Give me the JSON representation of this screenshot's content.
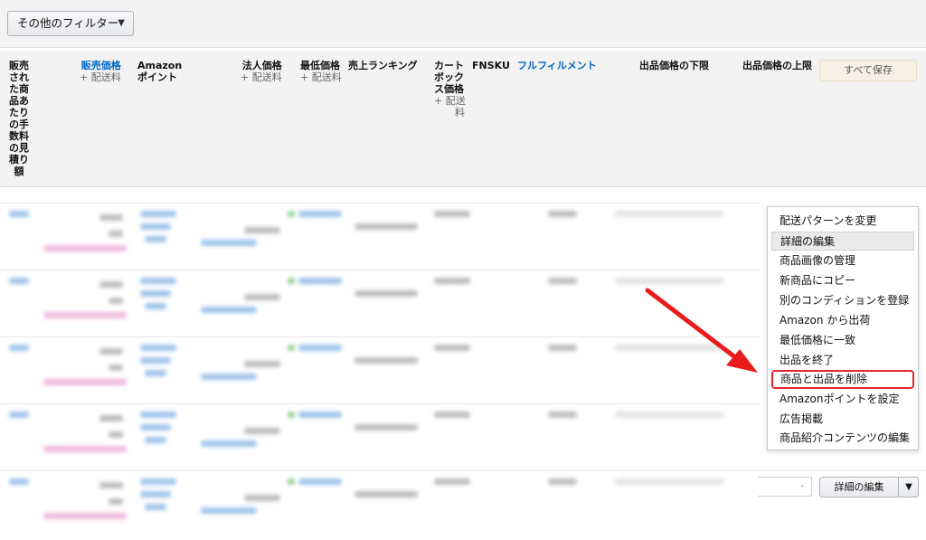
{
  "filter": {
    "label": "その他のフィルター"
  },
  "header": {
    "fee_lines": [
      "販売",
      "され",
      "た商",
      "品あ",
      "たり",
      "の手",
      "数料",
      "の見",
      "積り",
      "額"
    ],
    "sale_price": "販売価格",
    "shipping": "+ 配送料",
    "amazon_point_1": "Amazon",
    "amazon_point_2": "ポイント",
    "business_price": "法人価格",
    "lowest_price": "最低価格",
    "sales_rank": "売上ランキング",
    "cart_lines": [
      "カート",
      "ボック",
      "ス価格"
    ],
    "cart_ship_1": "+ 配送",
    "cart_ship_2": "料",
    "fnsku": "FNSKU",
    "fulfillment": "フルフィルメント",
    "min_price": "出品価格の下限",
    "max_price": "出品価格の上限",
    "save_all": "すべて保存"
  },
  "row_controls": {
    "edit_button": "詳細の編集"
  },
  "menu": {
    "items": [
      "配送パターンを変更",
      "詳細の編集",
      "商品画像の管理",
      "新商品にコピー",
      "別のコンディションを登録",
      "Amazon から出荷",
      "最低価格に一致",
      "出品を終了",
      "商品と出品を削除",
      "Amazonポイントを設定",
      "広告掲載",
      "商品紹介コンテンツの編集"
    ],
    "hovered_index": 1,
    "highlighted_index": 8
  },
  "colors": {
    "link": "#0066c0",
    "highlight": "#e3252d",
    "arrow": "#e81c1c"
  }
}
